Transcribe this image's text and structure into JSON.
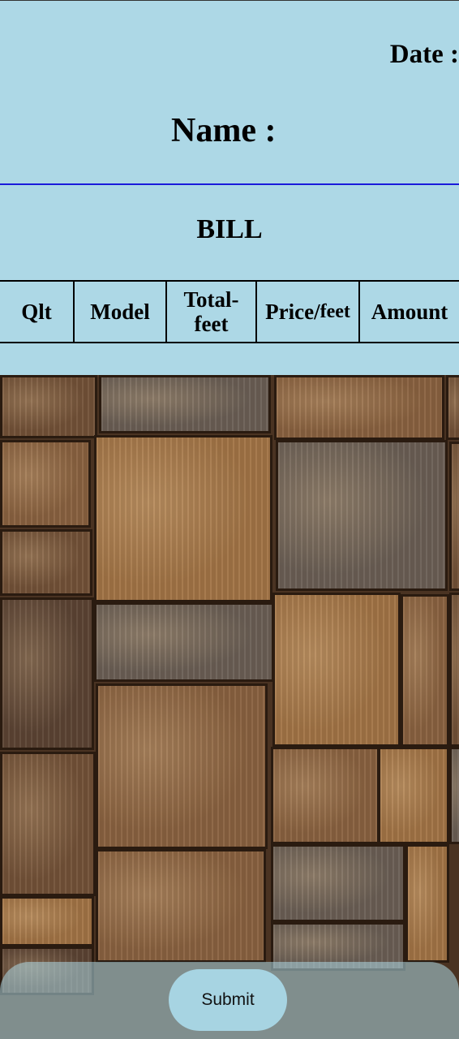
{
  "header": {
    "date_label": "Date :",
    "name_label": "Name :"
  },
  "bill": {
    "title": "BILL",
    "columns": {
      "qlt": "Qlt",
      "model": "Model",
      "total_feet": "Total-feet",
      "price_main": "Price/",
      "price_sub": "feet",
      "amount": "Amount"
    }
  },
  "footer": {
    "submit_label": "Submit"
  },
  "colors": {
    "background": "#add8e6",
    "divider": "#1a1adb",
    "button": "#a7d4e2"
  }
}
